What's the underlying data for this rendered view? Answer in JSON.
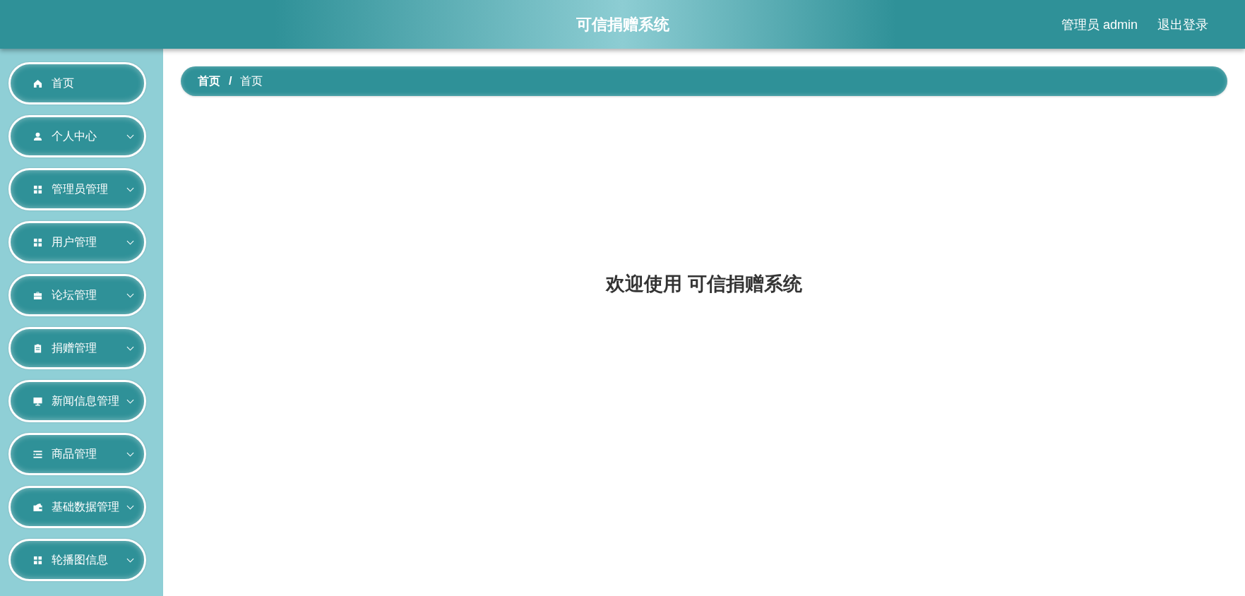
{
  "header": {
    "title": "可信捐赠系统",
    "user": "管理员 admin",
    "logout": "退出登录"
  },
  "sidebar": {
    "items": [
      {
        "label": "首页",
        "kind": "page"
      },
      {
        "label": "个人中心",
        "kind": "group",
        "expanded": false
      },
      {
        "label": "管理员管理",
        "kind": "group",
        "expanded": false
      },
      {
        "label": "用户管理",
        "kind": "group",
        "expanded": false
      },
      {
        "label": "论坛管理",
        "kind": "group",
        "expanded": false
      },
      {
        "label": "捐赠管理",
        "kind": "group",
        "expanded": false
      },
      {
        "label": "新闻信息管理",
        "kind": "group",
        "expanded": false
      },
      {
        "label": "商品管理",
        "kind": "group",
        "expanded": false
      },
      {
        "label": "基础数据管理",
        "kind": "group",
        "expanded": false
      },
      {
        "label": "轮播图信息",
        "kind": "group",
        "expanded": false
      }
    ]
  },
  "breadcrumb": {
    "separator": "/",
    "items": [
      {
        "label": "首页",
        "current": false
      },
      {
        "label": "首页",
        "current": true
      }
    ]
  },
  "welcome": "欢迎使用 可信捐赠系统"
}
